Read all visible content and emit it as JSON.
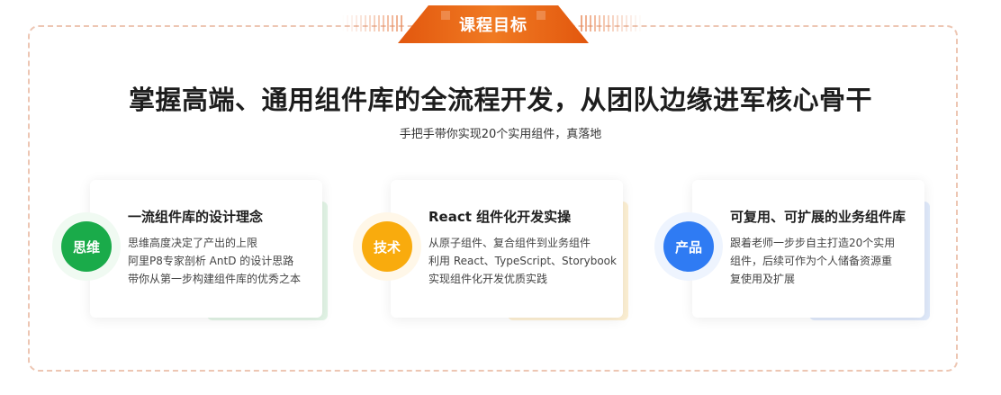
{
  "badge": {
    "label": "课程目标"
  },
  "headline": "掌握高端、通用组件库的全流程开发，从团队边缘进军核心骨干",
  "subheadline": "手把手带你实现20个实用组件，真落地",
  "colors": {
    "accent_orange": "#e8600f",
    "green": "#1aab4a",
    "amber": "#f9ab0d",
    "blue": "#2f7bf3"
  },
  "cards": [
    {
      "tag": "思维",
      "title": "一流组件库的设计理念",
      "lines": [
        "思维高度决定了产出的上限",
        "阿里P8专家剖析 AntD 的设计思路",
        "带你从第一步构建组件库的优秀之本"
      ]
    },
    {
      "tag": "技术",
      "title": "React 组件化开发实操",
      "lines": [
        "从原子组件、复合组件到业务组件",
        "利用 React、TypeScript、Storybook",
        "实现组件化开发优质实践"
      ]
    },
    {
      "tag": "产品",
      "title": "可复用、可扩展的业务组件库",
      "lines": [
        "跟着老师一步步自主打造20个实用",
        "组件，后续可作为个人储备资源重",
        "复使用及扩展"
      ]
    }
  ]
}
